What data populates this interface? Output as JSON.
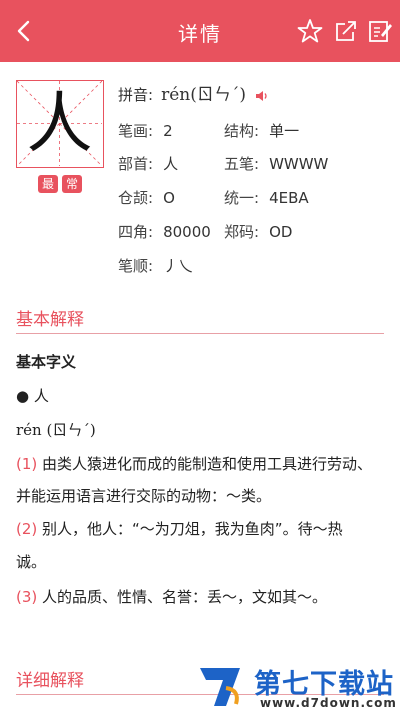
{
  "header": {
    "title": "详情"
  },
  "character": {
    "glyph": "人",
    "badges": [
      "最",
      "常"
    ]
  },
  "info": {
    "pinyin_label": "拼音:",
    "pinyin_value": "rén(ㄖㄣˊ)",
    "strokes_label": "笔画:",
    "strokes_value": "2",
    "structure_label": "结构:",
    "structure_value": "单一",
    "radical_label": "部首:",
    "radical_value": "人",
    "wubi_label": "五笔:",
    "wubi_value": "WWWW",
    "cangjie_label": "仓颉:",
    "cangjie_value": "O",
    "unicode_label": "统一:",
    "unicode_value": "4EBA",
    "sijiao_label": "四角:",
    "sijiao_value": "80000",
    "zhengma_label": "郑码:",
    "zhengma_value": "OD",
    "order_label": "笔顺:",
    "order_value": "丿乀"
  },
  "basic": {
    "heading": "基本解释",
    "subheading": "基本字义",
    "entry_char": "● 人",
    "entry_pinyin": "rén (ㄖㄣˊ)",
    "definitions": [
      {
        "num": "(1)",
        "text": "由类人猿进化而成的能制造和使用工具进行劳动、"
      },
      {
        "num": "",
        "text": "并能运用语言进行交际的动物：～类。"
      },
      {
        "num": "(2)",
        "text": "别人，他人：“～为刀俎，我为鱼肉”。待～热"
      },
      {
        "num": "",
        "text": "诚。"
      },
      {
        "num": "(3)",
        "text": "人的品质、性情、名誉：丢～，文如其～。"
      }
    ]
  },
  "detail": {
    "heading": "详细解释"
  },
  "watermark": {
    "text": "第七下载站",
    "url": "www.d7down.com"
  },
  "colors": {
    "accent": "#e8525e",
    "watermark_blue": "#1d63c7"
  }
}
